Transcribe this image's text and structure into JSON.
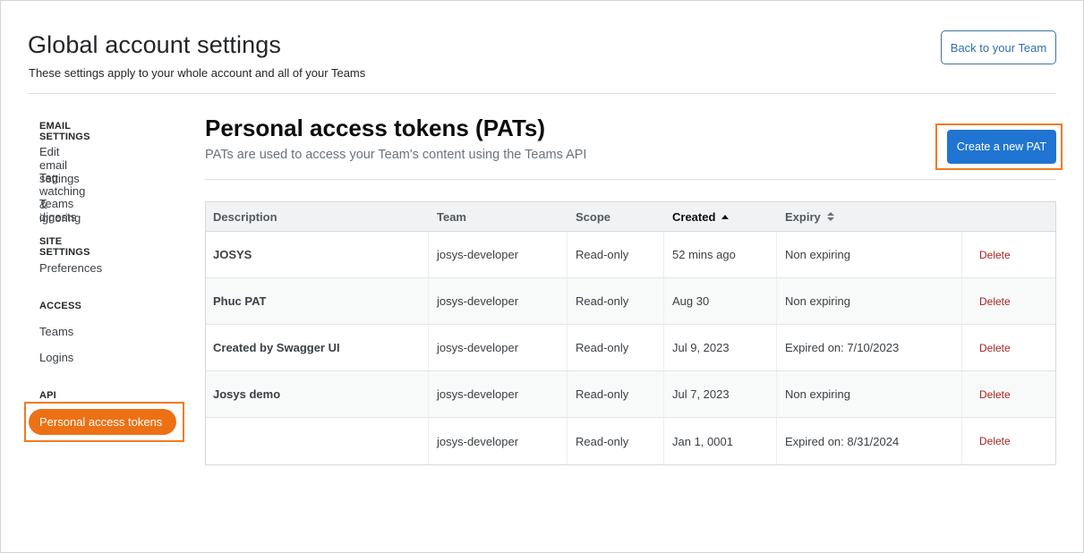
{
  "header": {
    "title": "Global account settings",
    "subtitle": "These settings apply to your whole account and all of your Teams",
    "back_button": "Back to your Team"
  },
  "sidebar": {
    "sections": [
      {
        "heading": "EMAIL SETTINGS",
        "items": [
          "Edit email settings",
          "Tag watching & ignoring",
          "Teams digests"
        ]
      },
      {
        "heading": "SITE SETTINGS",
        "items": [
          "Preferences"
        ]
      },
      {
        "heading": "ACCESS",
        "items": [
          "Teams",
          "Logins"
        ]
      },
      {
        "heading": "API",
        "items": [
          "Personal access tokens"
        ]
      }
    ],
    "active_item": "Personal access tokens"
  },
  "main": {
    "title": "Personal access tokens (PATs)",
    "subtitle": "PATs are used to access your Team's content using the Teams API",
    "create_button": "Create a new PAT",
    "accent_color": "#1f75d1",
    "highlight_color": "#ef7b22"
  },
  "table": {
    "columns": [
      "Description",
      "Team",
      "Scope",
      "Created",
      "Expiry"
    ],
    "sorted_column": "Created",
    "rows": [
      {
        "description": "JOSYS",
        "team": "josys-developer",
        "scope": "Read-only",
        "created": "52 mins ago",
        "expiry": "Non expiring",
        "action": "Delete"
      },
      {
        "description": "Phuc PAT",
        "team": "josys-developer",
        "scope": "Read-only",
        "created": "Aug 30",
        "expiry": "Non expiring",
        "action": "Delete"
      },
      {
        "description": "Created by Swagger UI",
        "team": "josys-developer",
        "scope": "Read-only",
        "created": "Jul 9, 2023",
        "expiry": "Expired on: 7/10/2023",
        "action": "Delete"
      },
      {
        "description": "Josys demo",
        "team": "josys-developer",
        "scope": "Read-only",
        "created": "Jul 7, 2023",
        "expiry": "Non expiring",
        "action": "Delete"
      },
      {
        "description": "",
        "team": "josys-developer",
        "scope": "Read-only",
        "created": "Jan 1, 0001",
        "expiry": "Expired on: 8/31/2024",
        "action": "Delete"
      }
    ]
  }
}
